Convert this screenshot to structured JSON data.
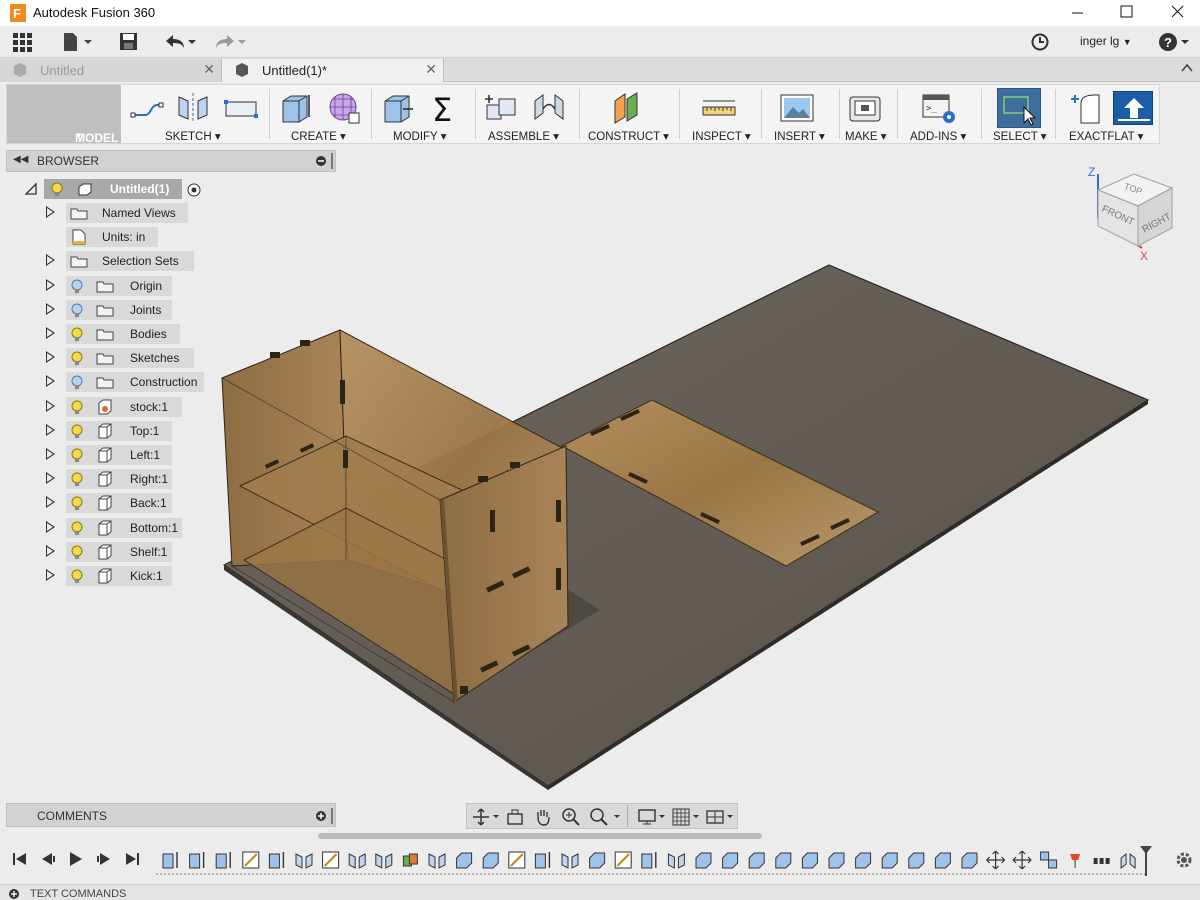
{
  "window": {
    "title": "Autodesk Fusion 360"
  },
  "user": {
    "name": "inger lg"
  },
  "tabs": [
    {
      "label": "Untitled",
      "active": false
    },
    {
      "label": "Untitled(1)*",
      "active": true
    }
  ],
  "toolbar": {
    "workspace": "MODEL",
    "groups": [
      "SKETCH",
      "CREATE",
      "MODIFY",
      "ASSEMBLE",
      "CONSTRUCT",
      "INSPECT",
      "INSERT",
      "MAKE",
      "ADD-INS",
      "SELECT",
      "EXACTFLAT"
    ]
  },
  "browser": {
    "title": "BROWSER",
    "root": "Untitled(1)",
    "items": [
      {
        "label": "Named Views"
      },
      {
        "label": "Units: in"
      },
      {
        "label": "Selection Sets"
      },
      {
        "label": "Origin"
      },
      {
        "label": "Joints"
      },
      {
        "label": "Bodies"
      },
      {
        "label": "Sketches"
      },
      {
        "label": "Construction"
      },
      {
        "label": "stock:1"
      },
      {
        "label": "Top:1"
      },
      {
        "label": "Left:1"
      },
      {
        "label": "Right:1"
      },
      {
        "label": "Back:1"
      },
      {
        "label": "Bottom:1"
      },
      {
        "label": "Shelf:1"
      },
      {
        "label": "Kick:1"
      }
    ]
  },
  "viewcube": {
    "top": "TOP",
    "front": "FRONT",
    "right": "RIGHT",
    "axis_z": "Z",
    "axis_x": "X"
  },
  "comments": {
    "title": "COMMENTS"
  },
  "textcommands": {
    "title": "TEXT COMMANDS"
  }
}
